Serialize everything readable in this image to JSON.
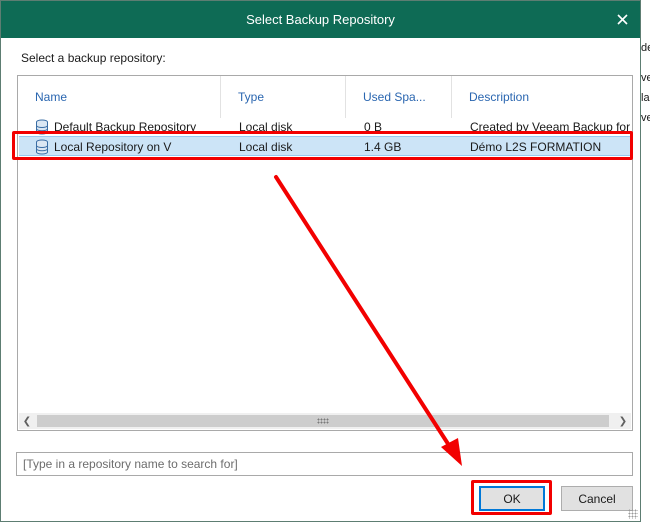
{
  "dialog": {
    "title": "Select Backup Repository",
    "prompt": "Select a backup repository:",
    "accent_color": "#0e6b55"
  },
  "table": {
    "columns": [
      "Name",
      "Type",
      "Used Spa...",
      "Description"
    ],
    "rows": [
      {
        "name": "Default Backup Repository",
        "type": "Local disk",
        "used": "0 B",
        "description": "Created by Veeam Backup for M",
        "selected": false
      },
      {
        "name": "Local Repository on V",
        "type": "Local disk",
        "used": "1.4 GB",
        "description": "Démo L2S FORMATION",
        "selected": true
      }
    ]
  },
  "search": {
    "placeholder": "[Type in a repository name to search for]"
  },
  "buttons": {
    "ok": "OK",
    "cancel": "Cancel"
  },
  "background_peek": {
    "lines": [
      "de",
      "ve",
      "la",
      "ve"
    ]
  },
  "annotation": {
    "color": "#f20000"
  }
}
